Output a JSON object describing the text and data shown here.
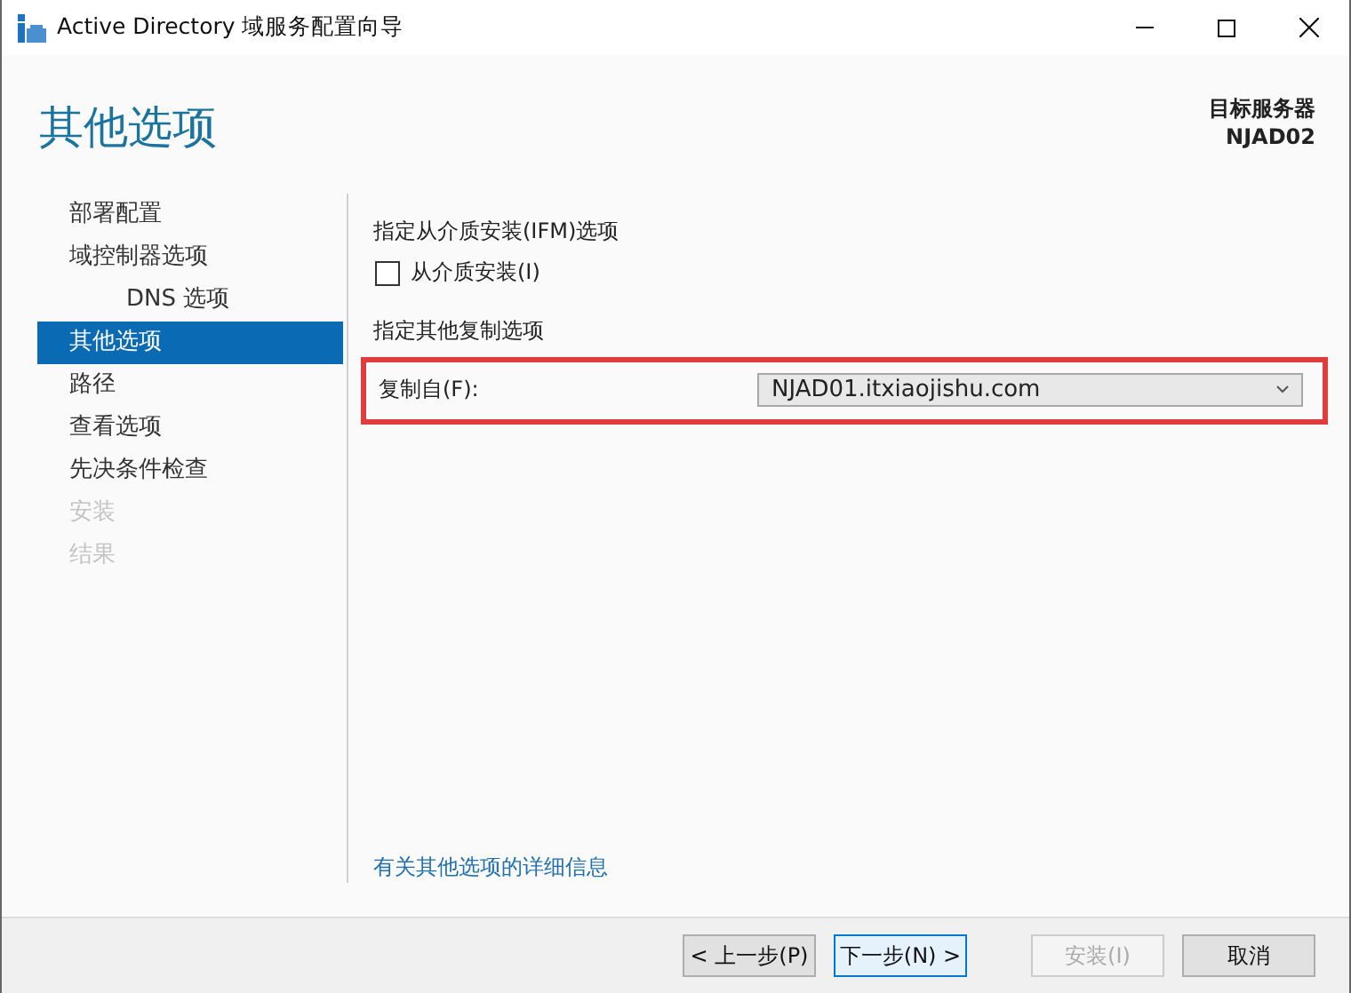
{
  "window": {
    "title": "Active Directory 域服务配置向导"
  },
  "header": {
    "title": "其他选项",
    "target_label": "目标服务器",
    "target_name": "NJAD02"
  },
  "sidebar": {
    "items": [
      {
        "label": "部署配置",
        "selected": false,
        "disabled": false
      },
      {
        "label": "域控制器选项",
        "selected": false,
        "disabled": false,
        "children": [
          {
            "label": "DNS 选项",
            "selected": false,
            "disabled": false
          }
        ]
      },
      {
        "label": "其他选项",
        "selected": true,
        "disabled": false
      },
      {
        "label": "路径",
        "selected": false,
        "disabled": false
      },
      {
        "label": "查看选项",
        "selected": false,
        "disabled": false
      },
      {
        "label": "先决条件检查",
        "selected": false,
        "disabled": false
      },
      {
        "label": "安装",
        "selected": false,
        "disabled": true
      },
      {
        "label": "结果",
        "selected": false,
        "disabled": true
      }
    ]
  },
  "ifm": {
    "heading": "指定从介质安装(IFM)选项",
    "checkbox": {
      "label": "从介质安装(I)",
      "checked": false
    }
  },
  "replication": {
    "heading": "指定其他复制选项",
    "highlighted": true,
    "field": {
      "label": "复制自(F):",
      "value": "NJAD01.itxiaojishu.com"
    }
  },
  "more_info_link": "有关其他选项的详细信息",
  "buttons": [
    {
      "label": "< 上一步(P)",
      "default": false,
      "disabled": false
    },
    {
      "label": "下一步(N) >",
      "default": true,
      "disabled": false
    },
    {
      "label": "安装(I)",
      "default": false,
      "disabled": true
    },
    {
      "label": "取消",
      "default": false,
      "disabled": false
    }
  ]
}
